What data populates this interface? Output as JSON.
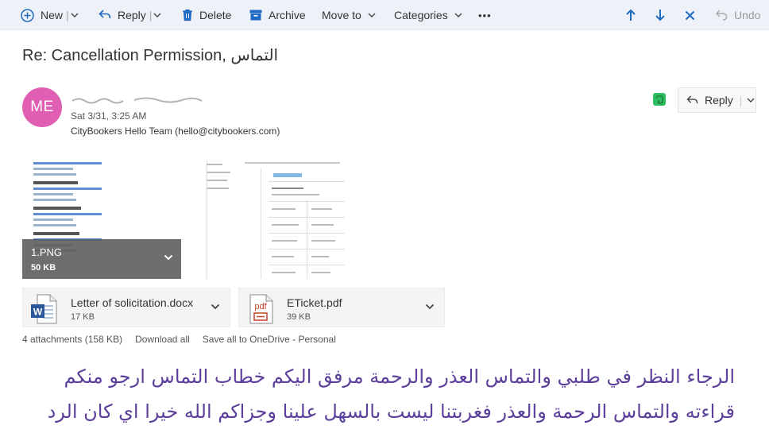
{
  "toolbar": {
    "new_label": "New",
    "reply_label": "Reply",
    "delete_label": "Delete",
    "archive_label": "Archive",
    "moveto_label": "Move to",
    "categories_label": "Categories",
    "more_label": "•••",
    "undo_label": "Undo"
  },
  "message": {
    "subject": "Re: Cancellation Permission, التماس",
    "avatar_initials": "ME",
    "date": "Sat 3/31, 3:25 AM",
    "to": "CityBookers Hello Team (hello@citybookers.com)",
    "reply_label": "Reply"
  },
  "image_attachments": [
    {
      "name": "1.PNG",
      "size": "50 KB"
    }
  ],
  "file_attachments": [
    {
      "name": "Letter of solicitation.docx",
      "size": "17 KB",
      "type": "word-icon"
    },
    {
      "name": "ETicket.pdf",
      "size": "39 KB",
      "type": "pdf-icon"
    }
  ],
  "attachments_bar": {
    "summary": "4 attachments (158 KB)",
    "download_all": "Download all",
    "save_onedrive": "Save all to OneDrive - Personal"
  },
  "body_lines": [
    "الرجاء النظر في طلبي والتماس العذر والرحمة مرفق اليكم خطاب التماس ارجو منكم",
    "قراءته والتماس الرحمة والعذر فغربتنا ليست بالسهل علينا وجزاكم الله خيرا اي كان الرد"
  ],
  "colors": {
    "accent": "#1f6ac2",
    "avatar": "#e05fb2",
    "body_text": "#5b3f9a"
  }
}
